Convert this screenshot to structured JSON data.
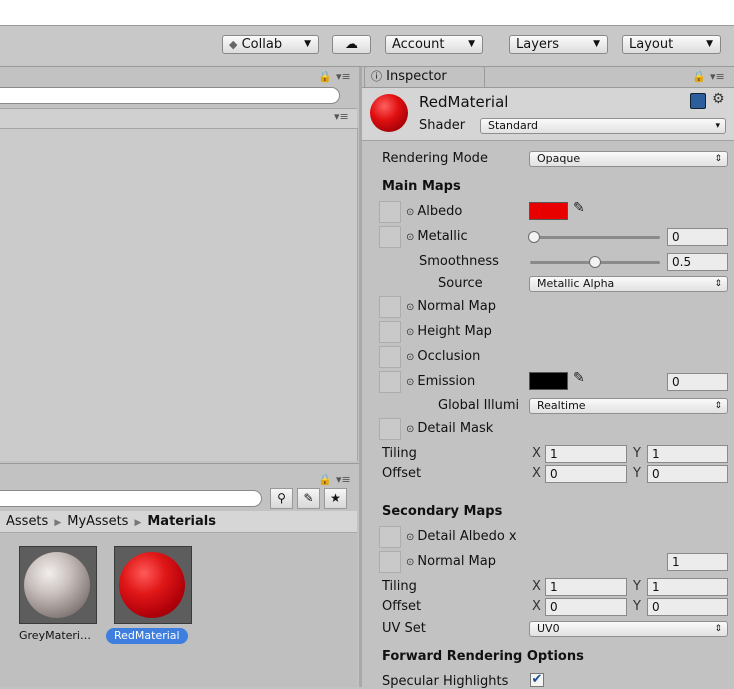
{
  "toolbar": {
    "collab": "Collab",
    "account": "Account",
    "layers": "Layers",
    "layout": "Layout"
  },
  "inspector": {
    "tab": "Inspector",
    "material_name": "RedMaterial",
    "shader_label": "Shader",
    "shader_value": "Standard",
    "rendering_mode_label": "Rendering Mode",
    "rendering_mode_value": "Opaque",
    "main_maps": "Main Maps",
    "albedo": "Albedo",
    "metallic": "Metallic",
    "metallic_value": "0",
    "smoothness": "Smoothness",
    "smoothness_value": "0.5",
    "source": "Source",
    "source_value": "Metallic Alpha",
    "normal_map": "Normal Map",
    "height_map": "Height Map",
    "occlusion": "Occlusion",
    "emission": "Emission",
    "emission_value": "0",
    "global_illum": "Global Illumi",
    "global_illum_value": "Realtime",
    "detail_mask": "Detail Mask",
    "tiling": "Tiling",
    "offset": "Offset",
    "x": "X",
    "y": "Y",
    "tiling_x": "1",
    "tiling_y": "1",
    "offset_x": "0",
    "offset_y": "0",
    "secondary_maps": "Secondary Maps",
    "detail_albedo": "Detail Albedo x",
    "normal_map2": "Normal Map",
    "normal_map2_value": "1",
    "tiling2": "Tiling",
    "offset2": "Offset",
    "tiling2_x": "1",
    "tiling2_y": "1",
    "offset2_x": "0",
    "offset2_y": "0",
    "uv_set": "UV Set",
    "uv_set_value": "UV0",
    "forward_rendering": "Forward Rendering Options",
    "specular_highlights": "Specular Highlights",
    "albedo_color": "#e80000",
    "emission_color": "#000000"
  },
  "project": {
    "breadcrumb": [
      "Assets",
      "MyAssets",
      "Materials"
    ],
    "assets": [
      {
        "name": "GreyMateri…"
      },
      {
        "name": "RedMaterial"
      }
    ]
  }
}
